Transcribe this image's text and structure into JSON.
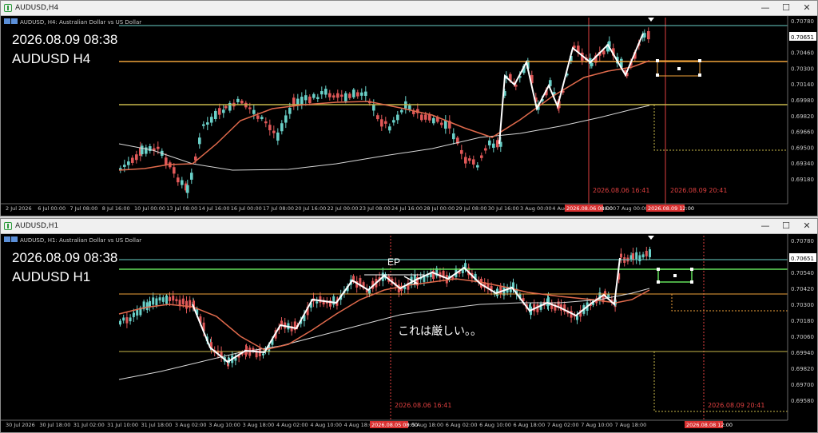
{
  "colors": {
    "background": "#000000",
    "bull_candle": "#6ad0c8",
    "bear_candle": "#e05858",
    "ma_fast": "#e06a4c",
    "ma_slow": "#d8d8d8",
    "zigzag": "#ffffff",
    "level_orange": "#f0a23a",
    "level_yellow": "#c8b84a",
    "level_green": "#62e05a",
    "vline_red": "#e04040",
    "axis_text": "#c8c8c8",
    "current_price_label_bg": "#ffffff"
  },
  "windows": [
    {
      "id": "h4",
      "title": "AUDUSD,H4",
      "chart_header": "AUDUSD, H4: Australian Dollar vs US Dollar",
      "overlay_time": "2026.08.09 08:38",
      "overlay_symbol": "AUDUSD H4",
      "price_labels": [
        "0.70780",
        "0.70651",
        "0.70460",
        "0.70300",
        "0.70140",
        "0.69980",
        "0.69820",
        "0.69660",
        "0.69500",
        "0.69340",
        "0.69180"
      ],
      "current_price": "0.70651",
      "time_labels": [
        "2 Jul 2026",
        "6 Jul 00:00",
        "7 Jul 08:00",
        "8 Jul 16:00",
        "10 Jul 00:00",
        "13 Jul 08:00",
        "14 Jul 16:00",
        "16 Jul 00:00",
        "17 Jul 08:00",
        "20 Jul 16:00",
        "22 Jul 00:00",
        "23 Jul 08:00",
        "24 Jul 16:00",
        "28 Jul 00:00",
        "29 Jul 08:00",
        "30 Jul 16:00",
        "3 Aug 00:00",
        "4 Aug 08:00",
        "5 Aug 16:00",
        "7 Aug 00:00"
      ],
      "vline_labels": [
        "2026.08.06 16:41",
        "2026.08.09 20:41"
      ],
      "axis_markers": [
        "2026.08.06 08:00",
        "2026.08.09 12:00"
      ]
    },
    {
      "id": "h1",
      "title": "AUDUSD,H1",
      "chart_header": "AUDUSD, H1: Australian Dollar vs US Dollar",
      "overlay_time": "2026.08.09 08:38",
      "overlay_symbol": "AUDUSD H1",
      "ep_label": "EP",
      "comment": "これは厳しい。。",
      "price_labels": [
        "0.70780",
        "0.70651",
        "0.70540",
        "0.70420",
        "0.70300",
        "0.70180",
        "0.70060",
        "0.69940",
        "0.69820",
        "0.69700",
        "0.69580"
      ],
      "current_price": "0.70651",
      "time_labels": [
        "30 Jul 2026",
        "30 Jul 18:00",
        "31 Jul 02:00",
        "31 Jul 10:00",
        "31 Jul 18:00",
        "3 Aug 02:00",
        "3 Aug 10:00",
        "3 Aug 18:00",
        "4 Aug 02:00",
        "4 Aug 10:00",
        "4 Aug 18:00",
        "5 Aug 10:00",
        "5 Aug 18:00",
        "6 Aug 02:00",
        "6 Aug 10:00",
        "6 Aug 18:00",
        "7 Aug 02:00",
        "7 Aug 10:00",
        "7 Aug 18:00"
      ],
      "vline_labels": [
        "2026.08.06 16:41",
        "2026.08.09 20:41"
      ],
      "axis_markers": [
        "2026.08.05 08:00",
        "2026.08.08 12:00"
      ]
    }
  ]
}
